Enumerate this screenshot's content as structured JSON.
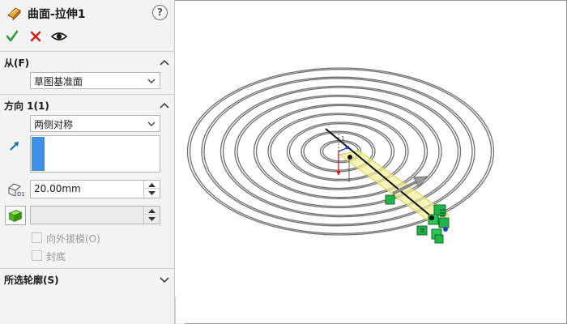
{
  "panel": {
    "title": "曲面-拉伸1",
    "title_icon": "surface-extrude-icon",
    "help_label": "?",
    "actions": {
      "ok_icon": "checkmark-icon",
      "cancel_icon": "x-icon",
      "preview_icon": "eye-icon"
    }
  },
  "from_group": {
    "title": "从(F)",
    "value": "草图基准面"
  },
  "direction_group": {
    "title": "方向 1(1)",
    "end_condition": "两侧对称",
    "depth_value": "20.00mm",
    "draft_value": "",
    "draft_outward_label": "向外拔模(O)",
    "draft_outward_checked": false,
    "cap_end_label": "封底",
    "cap_end_checked": false
  },
  "contours_group": {
    "title": "所选轮廓(S)"
  },
  "colors": {
    "selection_bar": "#3d8fe8",
    "ok_green": "#2e9b2e",
    "cancel_red": "#d11e1e",
    "preview_yellow": "#f3ee9a",
    "handle_green": "#22b24a",
    "spiral_gray": "#7a7a7a"
  }
}
